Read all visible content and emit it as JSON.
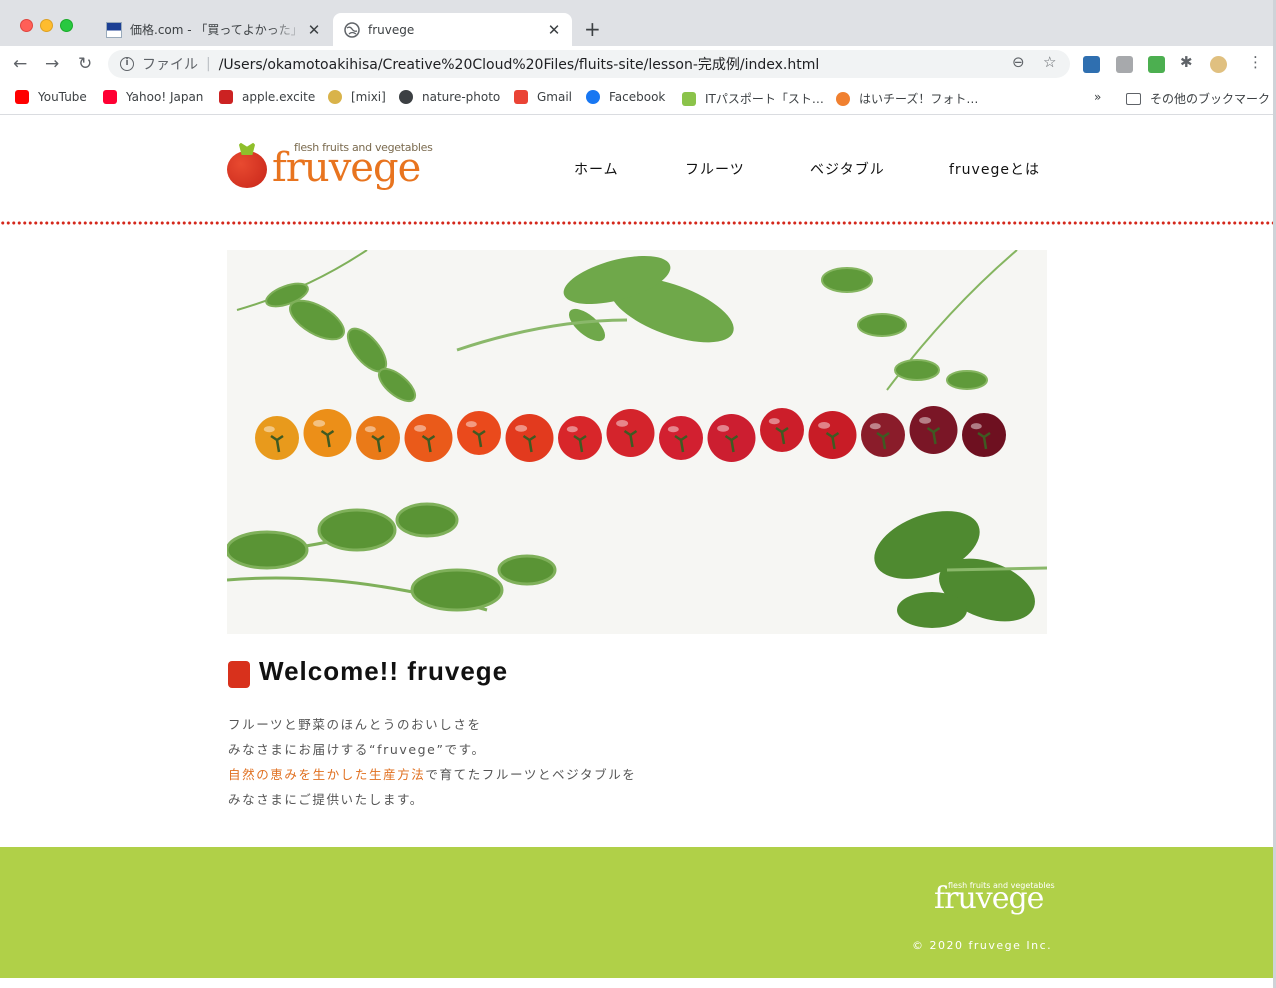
{
  "browser": {
    "tabs": [
      {
        "title": "価格.com - 「買ってよかった」を",
        "active": false
      },
      {
        "title": "fruvege",
        "active": true
      }
    ],
    "new_tab": "+",
    "omnibox": {
      "scheme_label": "ファイル",
      "separator": "|",
      "url": "/Users/okamotoakihisa/Creative%20Cloud%20Files/fluits-site/lesson-完成例/index.html"
    },
    "bookmarks": [
      {
        "label": "YouTube",
        "icon": "youtube-icon",
        "color": "#ff0000"
      },
      {
        "label": "Yahoo! Japan",
        "icon": "yahoo-icon",
        "color": "#ff0033"
      },
      {
        "label": "apple.excite",
        "icon": "excite-icon",
        "color": "#cc2222"
      },
      {
        "label": "[mixi]",
        "icon": "mixi-icon",
        "color": "#d9b34a"
      },
      {
        "label": "nature-photo",
        "icon": "globe-icon",
        "color": "#3c4043"
      },
      {
        "label": "Gmail",
        "icon": "gmail-icon",
        "color": "#ea4335"
      },
      {
        "label": "Facebook",
        "icon": "facebook-icon",
        "color": "#1877f2"
      },
      {
        "label": "ITパスポート「スト…",
        "icon": "itpass-icon",
        "color": "#8bc34a"
      },
      {
        "label": "はいチーズ！フォト…",
        "icon": "haicheese-icon",
        "color": "#f08030"
      }
    ],
    "bookmarks_overflow": "»",
    "other_bookmarks": "その他のブックマーク"
  },
  "site": {
    "logo": {
      "tagline": "flesh fruits and vegetables",
      "wordmark": "fruvege"
    },
    "nav": [
      "ホーム",
      "フルーツ",
      "ベジタブル",
      "fruvegeとは"
    ],
    "hero": {
      "tomato_count": 15
    },
    "welcome_title": "Welcome!! fruvege",
    "intro": {
      "line1": "フルーツと野菜のほんとうのおいしさを",
      "line2": "みなさまにお届けする“fruvege”です。",
      "line3_highlight": "自然の恵みを生かした生産方法",
      "line3_rest": "で育てたフルーツとベジタブルを",
      "line4": "みなさまにご提供いたします。"
    },
    "footer": {
      "tagline": "flesh fruits and vegetables",
      "wordmark": "fruvege",
      "copyright": "© 2020 fruvege Inc."
    },
    "colors": {
      "accent_red": "#d8311c",
      "logo_orange": "#e8741f",
      "footer_green": "#b0d048",
      "highlight_orange": "#e07020"
    }
  }
}
